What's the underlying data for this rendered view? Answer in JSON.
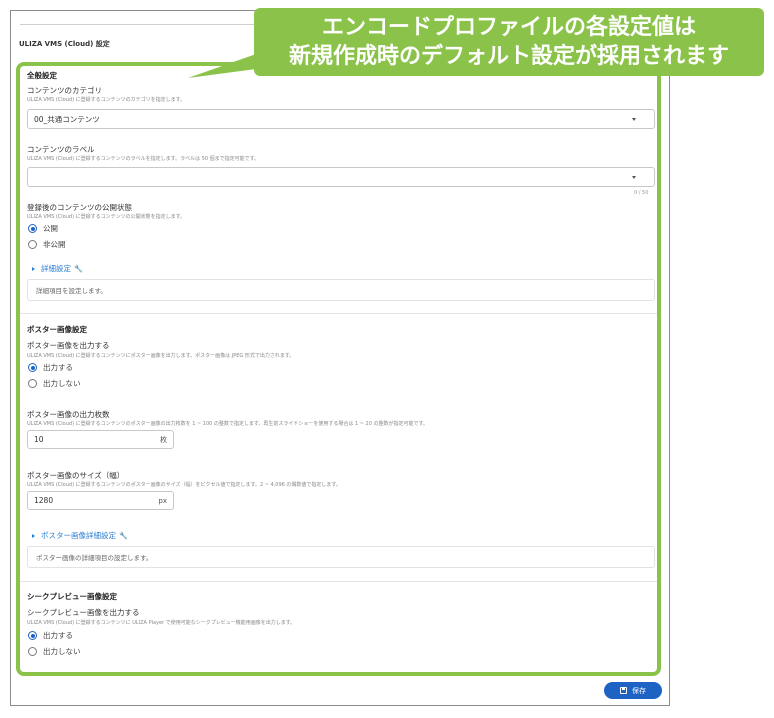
{
  "page": {
    "section_title": "ULIZA VMS (Cloud) 設定"
  },
  "callout": {
    "line1": "エンコードプロファイルの各設定値は",
    "line2": "新規作成時のデフォルト設定が採用されます"
  },
  "general": {
    "heading": "全般設定",
    "category": {
      "label": "コンテンツのカテゴリ",
      "help": "ULIZA VMS (Cloud) に登録するコンテンツのカテゴリを指定します。",
      "value": "00_共通コンテンツ"
    },
    "labels": {
      "label": "コンテンツのラベル",
      "help": "ULIZA VMS (Cloud) に登録するコンテンツのラベルを指定します。ラベルは 50 個まで指定可能です。",
      "value": "",
      "counter": "0 / 50"
    },
    "publish": {
      "label": "登録後のコンテンツの公開状態",
      "help": "ULIZA VMS (Cloud) に登録するコンテンツの公開状態を指定します。",
      "options": [
        "公開",
        "非公開"
      ],
      "selected": "公開"
    },
    "advanced_link": "詳細設定",
    "advanced_text": "詳細項目を設定します。"
  },
  "poster": {
    "heading": "ポスター画像設定",
    "output": {
      "label": "ポスター画像を出力する",
      "help": "ULIZA VMS (Cloud) に登録するコンテンツにポスター画像を出力します。ポスター画像は JPEG 形式で出力されます。",
      "options": [
        "出力する",
        "出力しない"
      ],
      "selected": "出力する"
    },
    "count": {
      "label": "ポスター画像の出力枚数",
      "help": "ULIZA VMS (Cloud) に登録するコンテンツのポスター画像の出力枚数を 1 ~ 100 の整数で指定します。再生前スライドショーを使用する場合は 1 ~ 20 の整数が指定可能です。",
      "value": "10",
      "suffix": "枚"
    },
    "width": {
      "label": "ポスター画像のサイズ（幅）",
      "help": "ULIZA VMS (Cloud) に登録するコンテンツのポスター画像のサイズ（幅）をピクセル値で指定します。2 ~ 4,096 の偶数値で指定します。",
      "value": "1280",
      "suffix": "px"
    },
    "advanced_link": "ポスター画像詳細設定",
    "advanced_text": "ポスター画像の詳細項目の設定します。"
  },
  "seek": {
    "heading": "シークプレビュー画像設定",
    "output": {
      "label": "シークプレビュー画像を出力する",
      "help": "ULIZA VMS (Cloud) に登録するコンテンツに ULIZA Player で使用可能なシークプレビュー機能用画像を出力します。",
      "options": [
        "出力する",
        "出力しない"
      ],
      "selected": "出力する"
    }
  },
  "footer": {
    "save_label": "保存"
  },
  "colors": {
    "accent": "#1e63c4",
    "highlight": "#8bc34a",
    "link": "#2a7fd4"
  }
}
